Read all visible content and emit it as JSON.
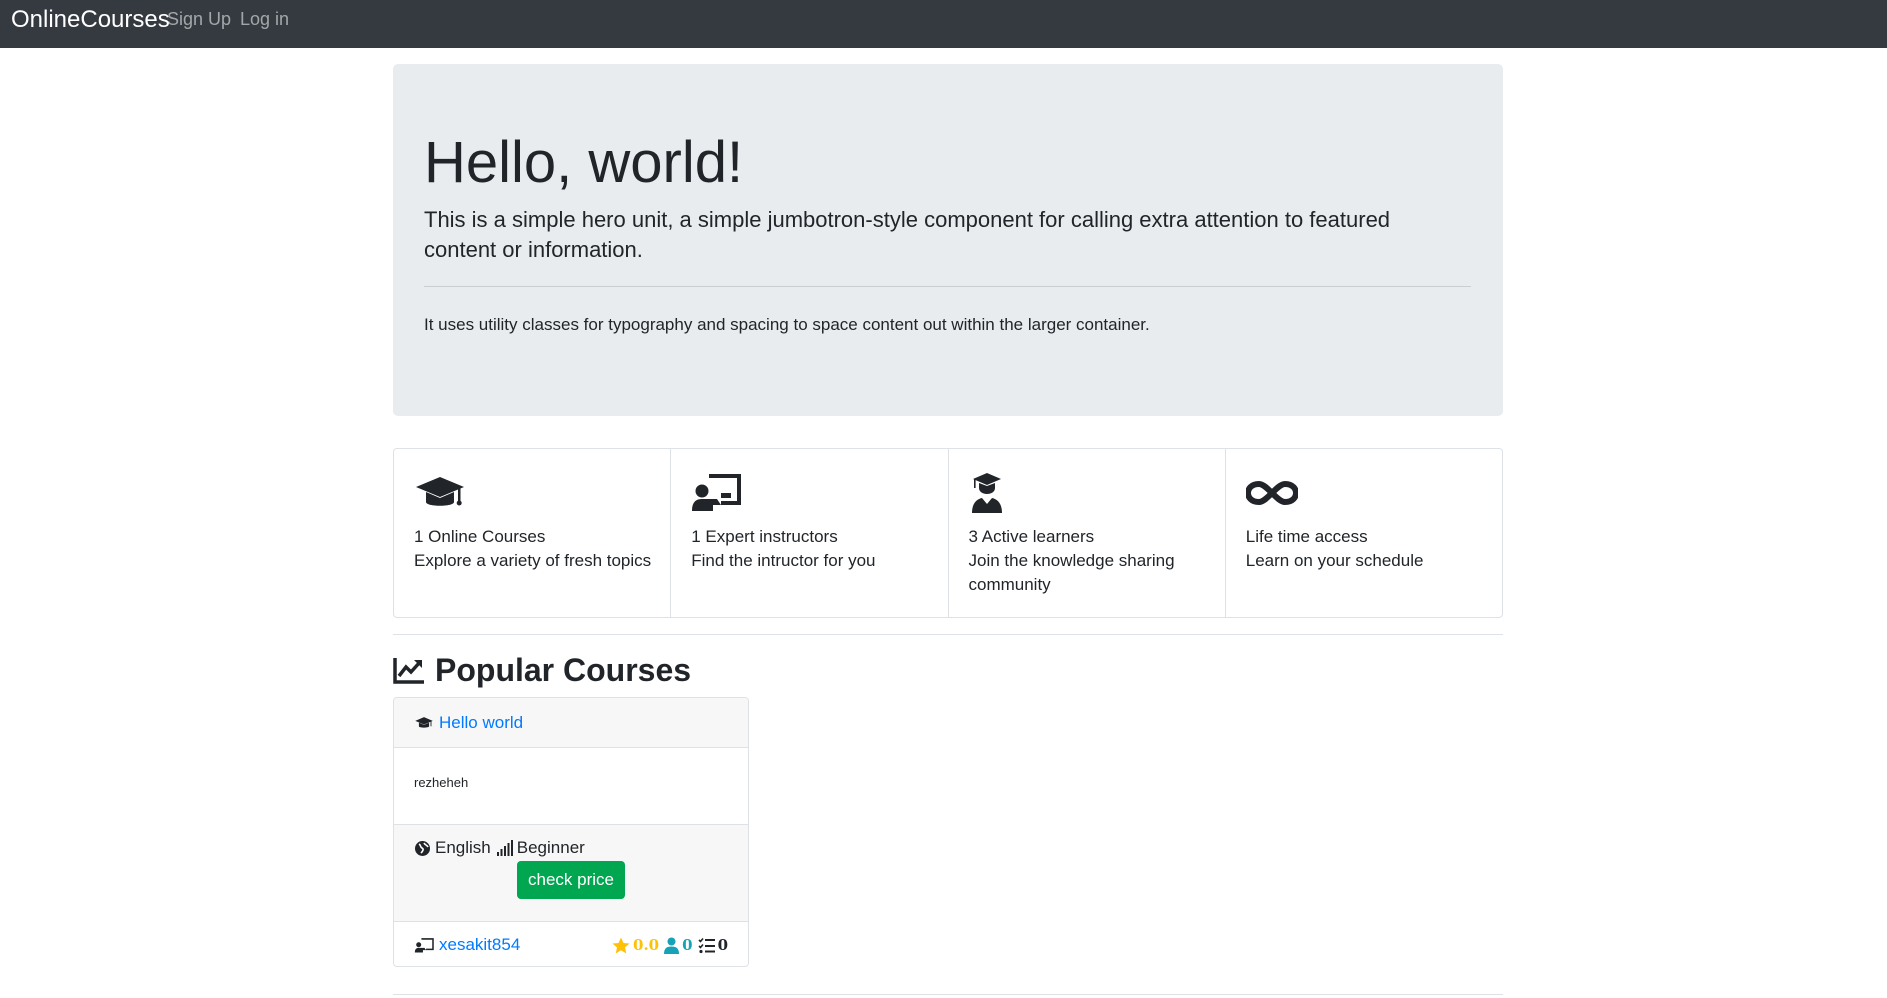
{
  "navbar": {
    "brand": "OnlineCourses",
    "links": [
      "Sign Up",
      "Log in"
    ]
  },
  "jumbotron": {
    "title": "Hello, world!",
    "lead": "This is a simple hero unit, a simple jumbotron-style component for calling extra attention to featured content or information.",
    "text": "It uses utility classes for typography and spacing to space content out within the larger container."
  },
  "features": [
    {
      "icon": "graduation-cap-icon",
      "title": "1 Online Courses",
      "subtitle": "Explore a variety of fresh topics"
    },
    {
      "icon": "chalkboard-teacher-icon",
      "title": "1 Expert instructors",
      "subtitle": "Find the intructor for you"
    },
    {
      "icon": "user-graduate-icon",
      "title": "3 Active learners",
      "subtitle": "Join the knowledge sharing community"
    },
    {
      "icon": "infinity-icon",
      "title": "Life time access",
      "subtitle": "Learn on your schedule"
    }
  ],
  "popular": {
    "icon": "chart-line-icon",
    "title": "Popular Courses"
  },
  "courses": [
    {
      "title": "Hello world",
      "description": "rezheheh",
      "language": "English",
      "level": "Beginner",
      "button": "check price",
      "instructor": "xesakit854",
      "rating": "0.0",
      "students": "0",
      "lessons": "0"
    }
  ],
  "colors": {
    "navbar": "#343a40",
    "jumbotron": "#e9ecef",
    "link": "#007bff",
    "button": "#00a650",
    "rating": "#ffc107",
    "students": "#17a2b8"
  }
}
